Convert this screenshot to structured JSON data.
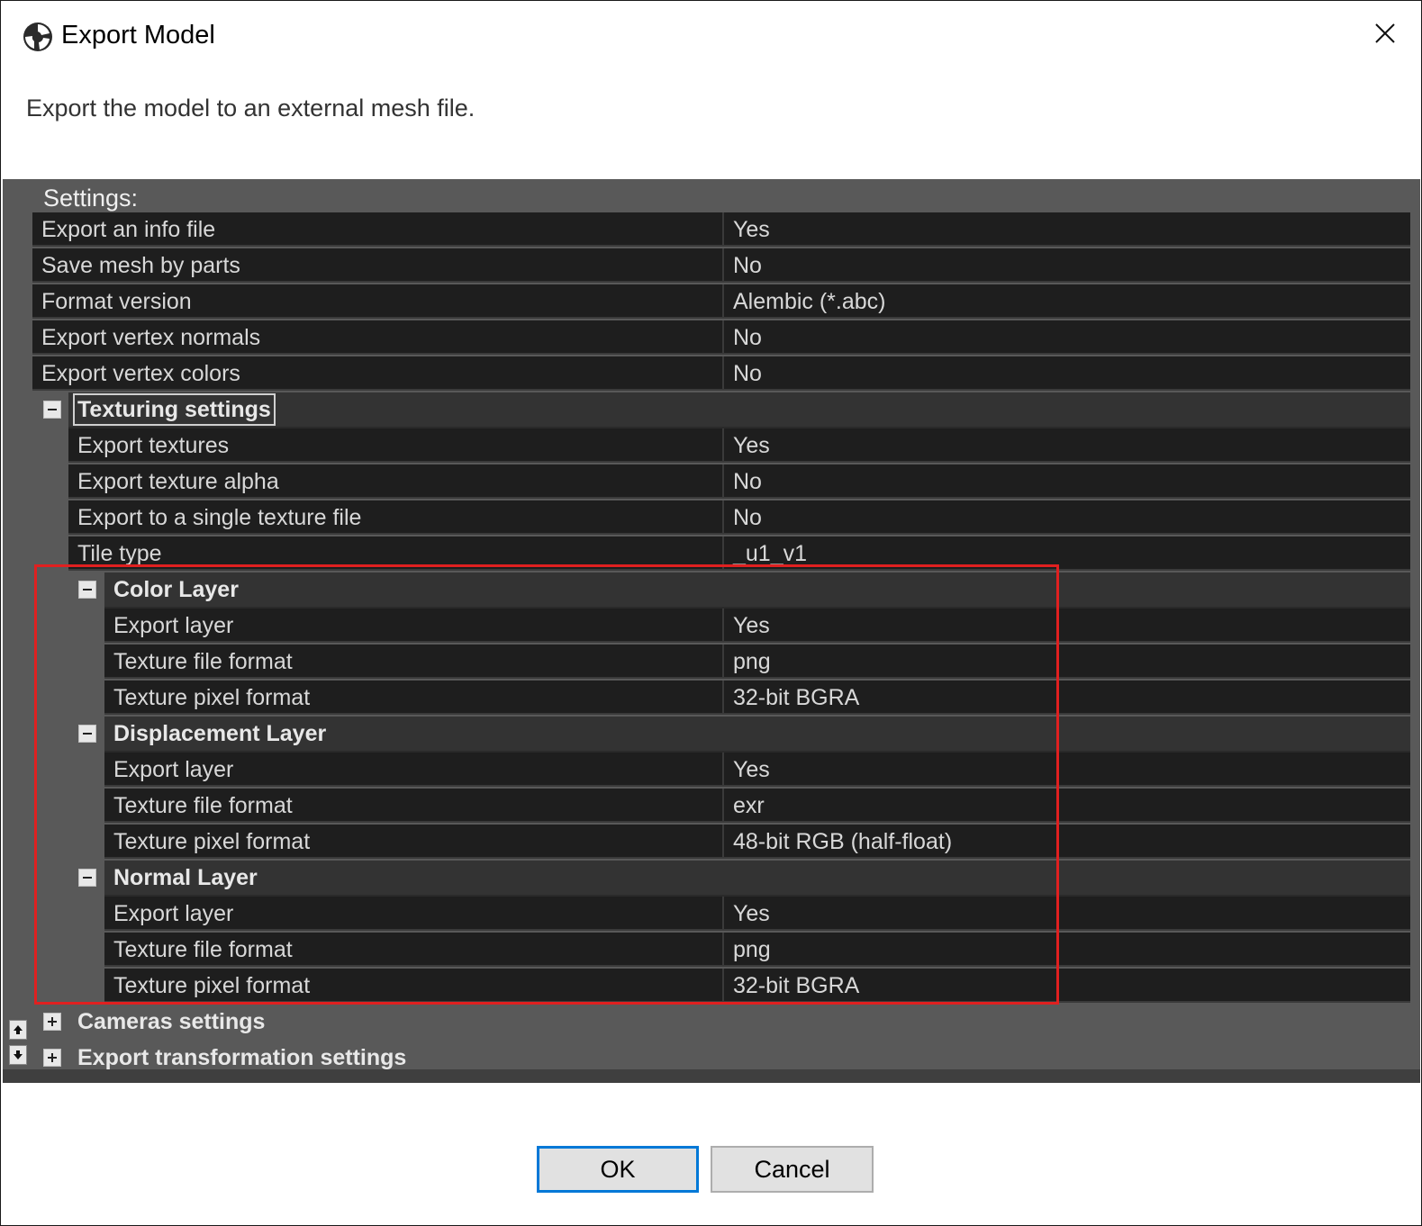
{
  "window": {
    "title": "Export Model",
    "description": "Export the model to an external mesh file."
  },
  "settings": {
    "header": "Settings:",
    "general": [
      {
        "label": "Export an info file",
        "value": "Yes"
      },
      {
        "label": "Save mesh by parts",
        "value": "No"
      },
      {
        "label": "Format version",
        "value": "Alembic (*.abc)"
      },
      {
        "label": "Export vertex normals",
        "value": "No"
      },
      {
        "label": "Export vertex colors",
        "value": "No"
      }
    ],
    "texturing": {
      "label": "Texturing settings",
      "expanded": true,
      "props": [
        {
          "label": "Export textures",
          "value": "Yes"
        },
        {
          "label": "Export texture alpha",
          "value": "No"
        },
        {
          "label": "Export to a single texture file",
          "value": "No"
        },
        {
          "label": "Tile type",
          "value": "_u1_v1"
        }
      ],
      "layers": [
        {
          "label": "Color Layer",
          "props": [
            {
              "label": "Export layer",
              "value": "Yes"
            },
            {
              "label": "Texture file format",
              "value": "png"
            },
            {
              "label": "Texture pixel format",
              "value": "32-bit BGRA"
            }
          ]
        },
        {
          "label": "Displacement Layer",
          "props": [
            {
              "label": "Export layer",
              "value": "Yes"
            },
            {
              "label": "Texture file format",
              "value": "exr"
            },
            {
              "label": "Texture pixel format",
              "value": "48-bit RGB (half-float)"
            }
          ]
        },
        {
          "label": "Normal Layer",
          "props": [
            {
              "label": "Export layer",
              "value": "Yes"
            },
            {
              "label": "Texture file format",
              "value": "png"
            },
            {
              "label": "Texture pixel format",
              "value": "32-bit BGRA"
            }
          ]
        }
      ]
    },
    "collapsed": [
      {
        "label": "Cameras settings"
      },
      {
        "label": "Export transformation settings"
      }
    ]
  },
  "buttons": {
    "ok": "OK",
    "cancel": "Cancel"
  },
  "icons": {
    "app": "app-logo-icon",
    "close": "close-icon",
    "collapse": "minus-icon",
    "expand": "plus-icon",
    "scroll_up": "scroll-up-icon",
    "scroll_down": "scroll-down-icon"
  },
  "colors": {
    "highlight": "#e02020",
    "default_button_border": "#0078d7",
    "grid_background": "#1e1e1e",
    "panel_background": "#595959"
  }
}
